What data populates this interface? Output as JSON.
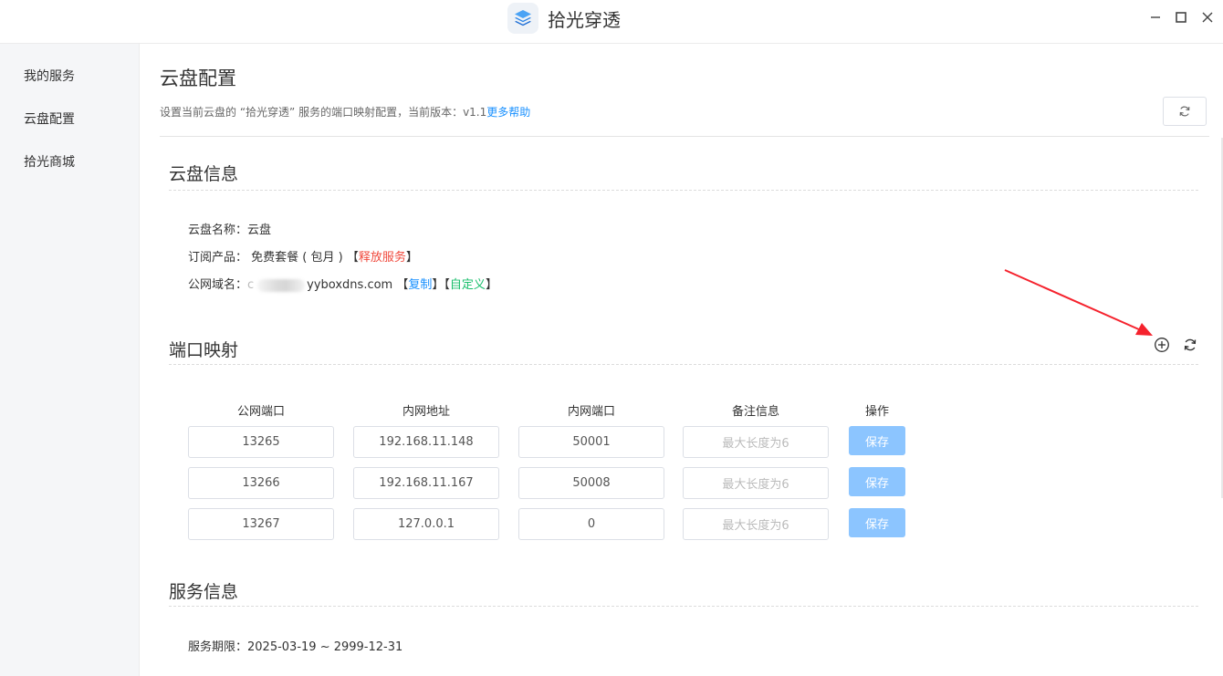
{
  "window": {
    "app_name": "拾光穿透",
    "minimize_glyph": "—",
    "maximize_glyph": "☐",
    "close_glyph": "✕"
  },
  "sidebar": {
    "items": [
      {
        "label": "我的服务"
      },
      {
        "label": "云盘配置"
      },
      {
        "label": "拾光商城"
      }
    ]
  },
  "page": {
    "title": "云盘配置",
    "desc": "设置当前云盘的 “拾光穿透” 服务的端口映射配置，当前版本：v1.1",
    "help_link": "更多帮助"
  },
  "cloud_info": {
    "title": "云盘信息",
    "name_label": "云盘名称：",
    "name_value": "云盘",
    "product_label": "订阅产品：",
    "product_value": "免费套餐 ( 包月 )",
    "bracket_open": "【",
    "bracket_close": "】",
    "release_link": "释放服务",
    "domain_label": "公网域名：",
    "domain_prefix": "c",
    "domain_suffix": "yyboxdns.com",
    "copy_link": "复制",
    "custom_link": "自定义"
  },
  "port_mapping": {
    "title": "端口映射",
    "columns": [
      "公网端口",
      "内网地址",
      "内网端口",
      "备注信息",
      "操作"
    ],
    "note_placeholder": "最大长度为6",
    "save_label": "保存",
    "rows": [
      {
        "public_port": "13265",
        "lan_addr": "192.168.11.148",
        "lan_port": "50001",
        "note": ""
      },
      {
        "public_port": "13266",
        "lan_addr": "192.168.11.167",
        "lan_port": "50008",
        "note": ""
      },
      {
        "public_port": "13267",
        "lan_addr": "127.0.0.1",
        "lan_port": "0",
        "note": ""
      }
    ]
  },
  "service_info": {
    "title": "服务信息",
    "period_label": "服务期限：",
    "period_value": "2025-03-19 ~ 2999-12-31"
  },
  "colors": {
    "accent": "#1890ff",
    "danger": "#f04a3d",
    "success": "#19be6b",
    "save_button": "#8cc5ff",
    "annotation_arrow": "#f5222d"
  },
  "icons": {
    "logo": "layers-icon",
    "refresh": "refresh-icon",
    "add": "plus-circle-icon"
  }
}
